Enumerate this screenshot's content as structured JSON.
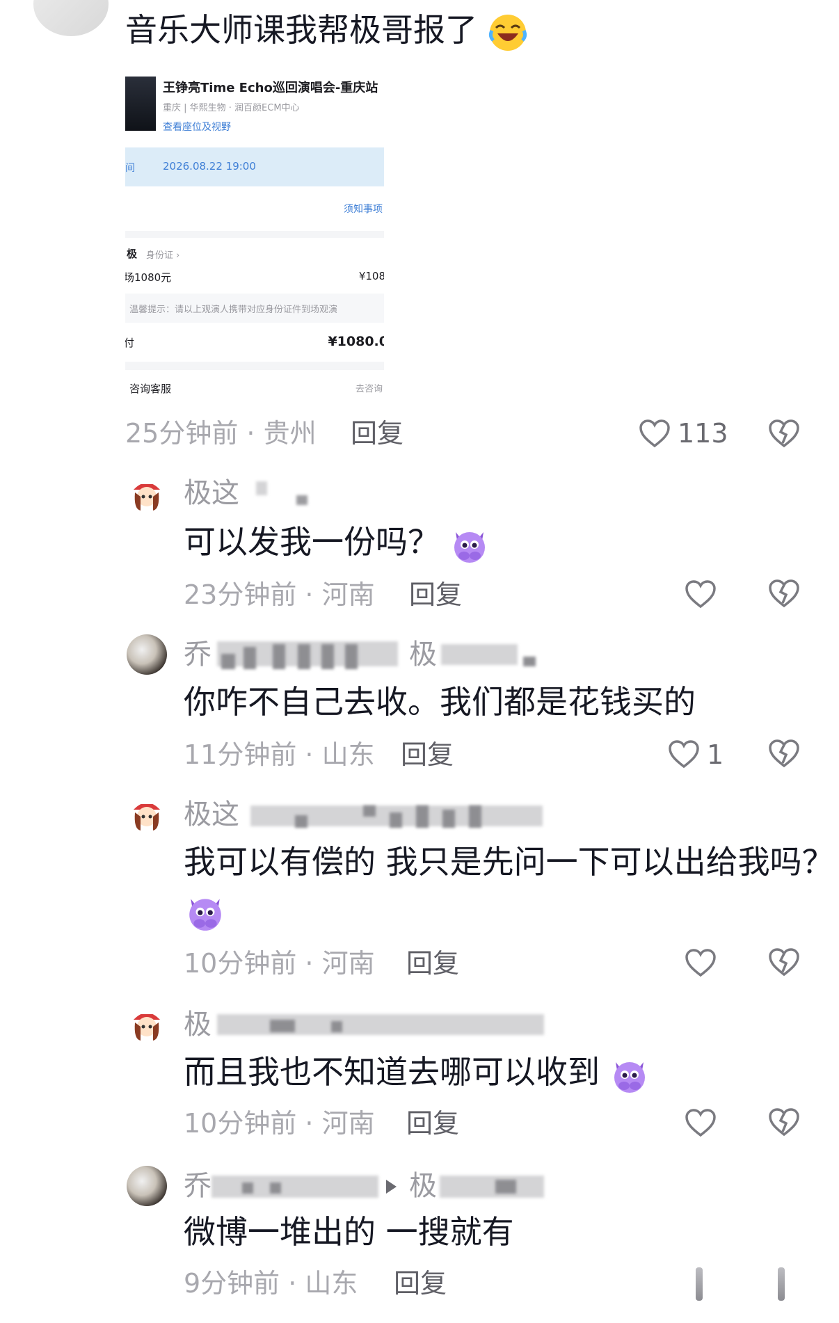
{
  "colors": {
    "text": "#161823",
    "meta": "#a8a8ae",
    "reply": "#5f5f66",
    "time_band": "#dcecf8",
    "link": "#3f7fd6",
    "emoji_purple": "#b68af4"
  },
  "top_comment": {
    "text": "音乐大师课我帮极哥报了",
    "emoji": "laughing-crying-emoji",
    "meta": "25分钟前 · 贵州",
    "reply_label": "回复",
    "likes": "113",
    "ticket": {
      "title": "王铮亮Time Echo巡回演唱会-重庆站",
      "location": "重庆 | 华熙生物 · 润百颜ECM中心",
      "seat_link": "查看座位及视野",
      "time_label": "时间",
      "time_value": "2026.08.22 19:00",
      "notice_link": "须知事项",
      "viewer_name": "极",
      "id_type": "身份证 ›",
      "price_label": "场1080元",
      "price_right": "¥108",
      "tip": "温馨提示：请以上观演人携带对应身份证件到场观演",
      "pay_label": "付",
      "pay_amount": "¥1080.0",
      "service_label": "咨询客服",
      "service_action": "去咨询"
    }
  },
  "replies": [
    {
      "name": "极这",
      "text": "可以发我一份吗？",
      "emoji": "pleading-devil-emoji",
      "meta": "23分钟前 · 河南",
      "reply_label": "回复",
      "likes": ""
    },
    {
      "name": "乔",
      "name_target": "极",
      "text": "你咋不自己去收。我们都是花钱买的",
      "meta": "11分钟前 · 山东",
      "reply_label": "回复",
      "likes": "1"
    },
    {
      "name": "极这",
      "text": "我可以有偿的 我只是先问一下可以出给我吗？",
      "emoji": "pleading-devil-emoji",
      "meta": "10分钟前 · 河南",
      "reply_label": "回复",
      "likes": ""
    },
    {
      "name": "极",
      "text": "而且我也不知道去哪可以收到",
      "emoji": "pleading-devil-emoji",
      "meta": "10分钟前 · 河南",
      "reply_label": "回复",
      "likes": ""
    },
    {
      "name": "乔",
      "name_target": "极",
      "text": "微博一堆出的 一搜就有",
      "meta": "9分钟前 · 山东",
      "reply_label": "回复",
      "likes": ""
    }
  ]
}
